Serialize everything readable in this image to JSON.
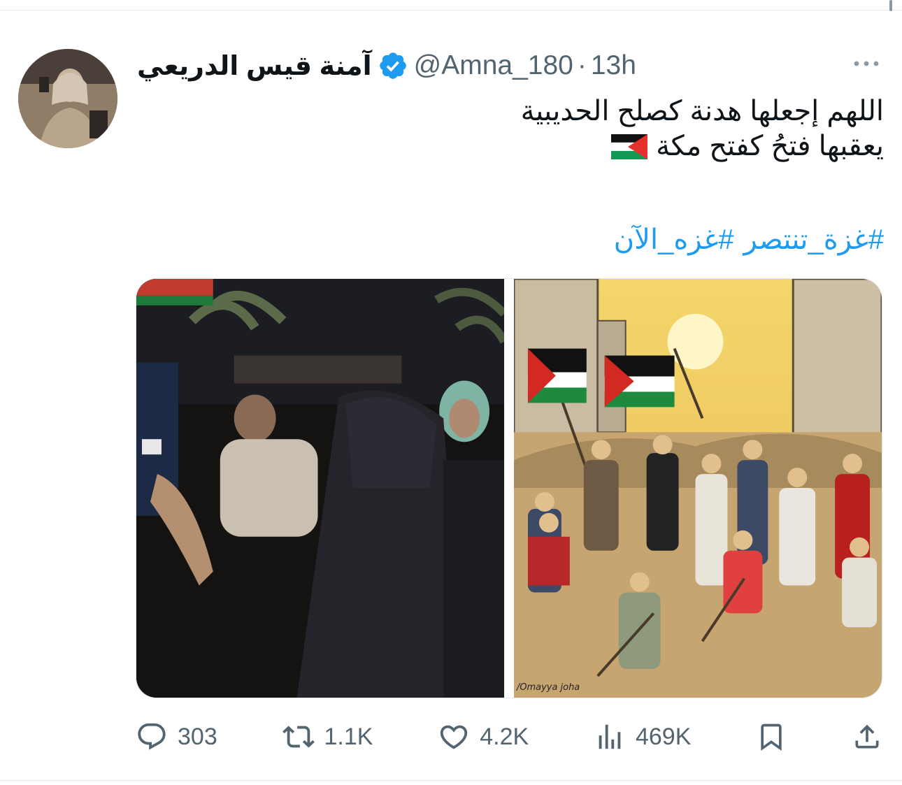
{
  "tweet": {
    "display_name": "آمنة قيس الدريعي",
    "handle": "@Amna_180",
    "separator": "·",
    "time": "13h",
    "text_lines": [
      "اللهم إجعلها هدنة كصلح الحديبية",
      "يعقبها فتحُ كفتح مكة"
    ],
    "flag_icon": "palestine-flag-icon",
    "hashtags": [
      "#غزة_تنتصر",
      "#غزه_الآن"
    ],
    "watermark": "/Omayya joha",
    "colors": {
      "link": "#1d9bf0",
      "verified": "#1d9bf0",
      "secondary_text": "#536471"
    }
  },
  "actions": {
    "replies": "303",
    "retweets": "1.1K",
    "likes": "4.2K",
    "views": "469K"
  }
}
